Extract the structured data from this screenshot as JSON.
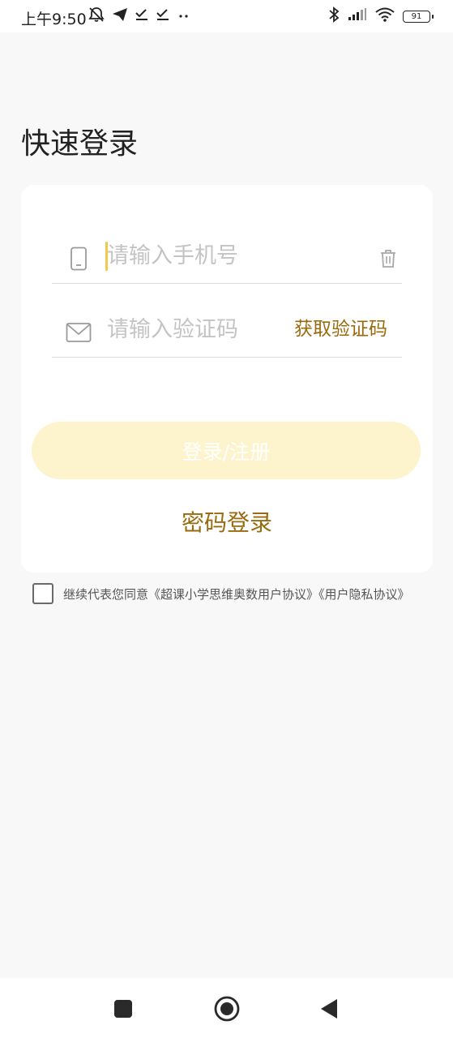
{
  "status_bar": {
    "time": "上午9:50",
    "battery": "91",
    "left_icons": [
      "mute-bell-icon",
      "send-icon",
      "check-icon",
      "check-icon",
      "more-dots-icon"
    ],
    "right_icons": [
      "bluetooth-icon",
      "signal-icon",
      "wifi-icon",
      "battery-icon"
    ]
  },
  "page": {
    "title": "快速登录"
  },
  "form": {
    "phone_placeholder": "请输入手机号",
    "phone_value": "",
    "code_placeholder": "请输入验证码",
    "code_value": "",
    "get_code_label": "获取验证码",
    "login_button_label": "登录/注册",
    "password_login_label": "密码登录",
    "accent_color": "#9a6a0e",
    "button_color": "#fdf4ce"
  },
  "agreement": {
    "prefix": "继续代表您同意",
    "user_agreement": "《超课小学思维奥数用户协议》",
    "privacy_agreement": "《用户隐私协议》",
    "checked": false
  },
  "nav_bar": {
    "buttons": [
      "recent-apps-icon",
      "home-icon",
      "back-icon"
    ]
  }
}
